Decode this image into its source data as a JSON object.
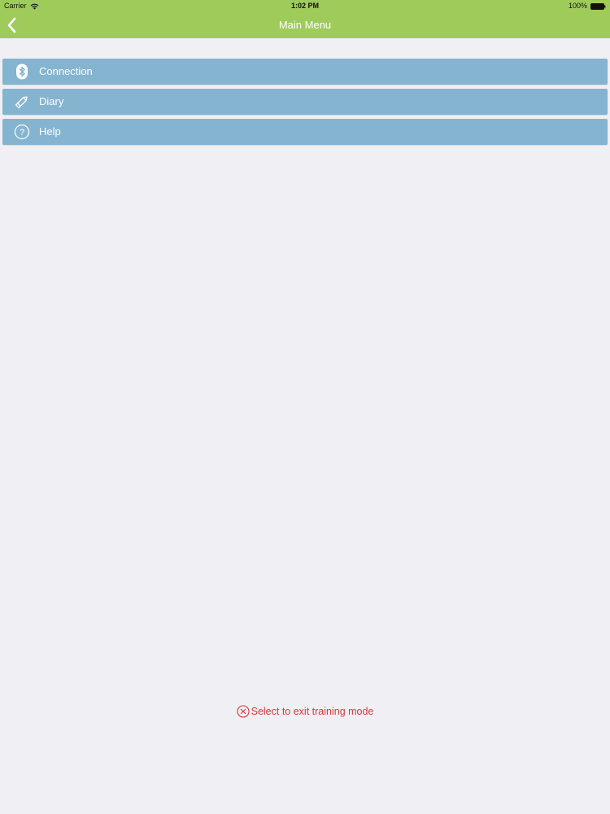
{
  "status_bar": {
    "carrier": "Carrier",
    "time": "1:02 PM",
    "battery": "100%",
    "icons": [
      "wifi-icon",
      "battery-icon"
    ]
  },
  "nav": {
    "title": "Main Menu",
    "back_icon": "chevron-left-icon"
  },
  "menu": {
    "items": [
      {
        "label": "Connection",
        "icon": "bluetooth-icon"
      },
      {
        "label": "Diary",
        "icon": "pencil-icon"
      },
      {
        "label": "Help",
        "icon": "question-circle-icon"
      }
    ]
  },
  "training": {
    "exit_label": "Select to exit training mode",
    "icon": "close-circle-icon"
  },
  "colors": {
    "header_green": "#9fcb5b",
    "menu_blue": "#85b4d0",
    "background": "#efeff4",
    "exit_red": "#d6393c"
  }
}
